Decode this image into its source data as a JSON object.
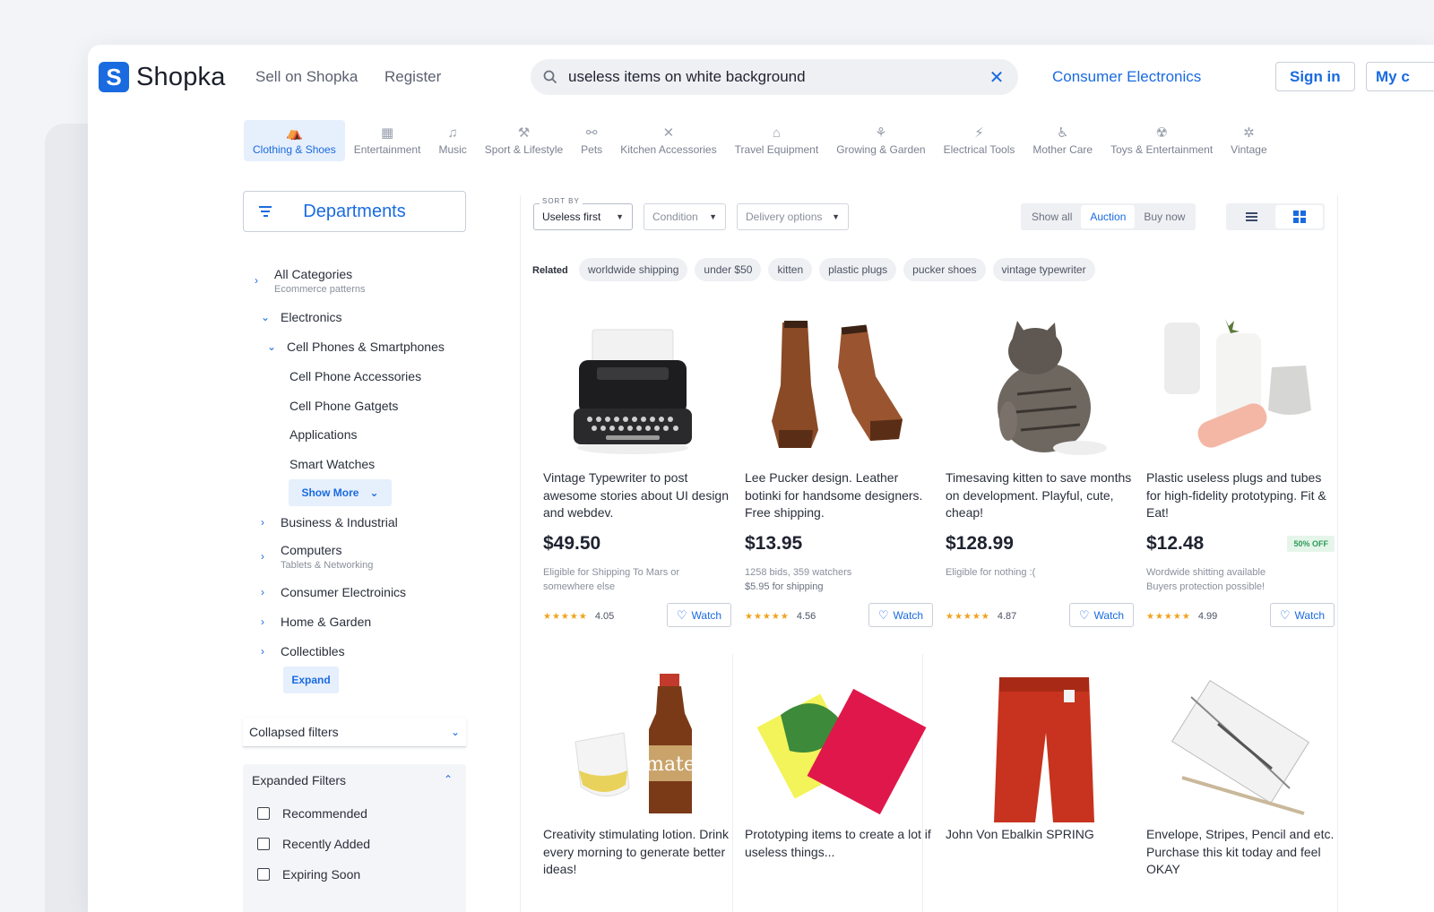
{
  "brand": {
    "mark": "S",
    "name": "Shopka"
  },
  "header": {
    "nav": [
      "Sell on Shopka",
      "Register"
    ],
    "search_value": "useless items on white background",
    "consumer_link": "Consumer Electronics",
    "sign_in": "Sign in",
    "my_label": "My c"
  },
  "categories": [
    {
      "label": "Clothing & Shoes",
      "icon": "hanger-icon",
      "glyph": "⛺",
      "active": true
    },
    {
      "label": "Entertainment",
      "icon": "film-icon",
      "glyph": "▦"
    },
    {
      "label": "Music",
      "icon": "music-note-icon",
      "glyph": "♫"
    },
    {
      "label": "Sport & Lifestyle",
      "icon": "racket-icon",
      "glyph": "⚒"
    },
    {
      "label": "Pets",
      "icon": "bone-icon",
      "glyph": "⚯"
    },
    {
      "label": "Kitchen Accessories",
      "icon": "utensils-icon",
      "glyph": "✕"
    },
    {
      "label": "Travel Equipment",
      "icon": "backpack-icon",
      "glyph": "⌂"
    },
    {
      "label": "Growing & Garden",
      "icon": "plant-icon",
      "glyph": "⚘"
    },
    {
      "label": "Electrical Tools",
      "icon": "plug-icon",
      "glyph": "⚡"
    },
    {
      "label": "Mother Care",
      "icon": "stroller-icon",
      "glyph": "♿"
    },
    {
      "label": "Toys & Entertainment",
      "icon": "toy-icon",
      "glyph": "☢"
    },
    {
      "label": "Vintage",
      "icon": "wheel-icon",
      "glyph": "✲"
    }
  ],
  "sidebar": {
    "departments": "Departments",
    "tree": {
      "all": "All Categories",
      "all_sub": "Ecommerce patterns",
      "electronics": "Electronics",
      "cell": "Cell Phones & Smartphones",
      "acc": "Cell Phone Accessories",
      "gat": "Cell Phone Gatgets",
      "apps": "Applications",
      "watches": "Smart Watches",
      "show_more": "Show More",
      "business": "Business & Industrial",
      "computers": "Computers",
      "computers_sub": "Tablets & Networking",
      "consumer": "Consumer Electroinics",
      "home": "Home & Garden",
      "collect": "Collectibles",
      "expand": "Expand"
    },
    "collapsed": "Collapsed filters",
    "expanded": "Expanded Filters",
    "checks": [
      "Recommended",
      "Recently Added",
      "Expiring Soon"
    ]
  },
  "toolbar": {
    "sort_label": "SORT BY",
    "sort_value": "Useless first",
    "condition": "Condition",
    "delivery": "Delivery options",
    "seg": [
      "Show all",
      "Auction",
      "Buy now"
    ],
    "active_seg": "Auction"
  },
  "related": {
    "label": "Related",
    "chips": [
      "worldwide shipping",
      "under $50",
      "kitten",
      "plastic plugs",
      "pucker shoes",
      "vintage typewriter"
    ]
  },
  "watch_label": "Watch",
  "products": [
    {
      "title": "Vintage Typewriter to post awesome stories about UI design and webdev.",
      "price": "$49.50",
      "meta1": "Eligible for Shipping To Mars or",
      "meta2": "somewhere else",
      "rating": "4.05",
      "image": "typewriter"
    },
    {
      "title": "Lee Pucker design. Leather botinki for handsome designers. Free shipping.",
      "price": "$13.95",
      "meta1": "1258 bids, 359 watchers",
      "meta2": "$5.95 for shipping",
      "rating": "4.56",
      "image": "boots"
    },
    {
      "title": "Timesaving kitten to save months on development. Playful, cute, cheap!",
      "price": "$128.99",
      "meta1": "",
      "meta2": "Eligible for nothing :(",
      "rating": "4.87",
      "image": "kitten"
    },
    {
      "title": "Plastic useless plugs and tubes for high-fidelity prototyping. Fit & Eat!",
      "price": "$12.48",
      "badge": "50% OFF",
      "meta1": "Wordwide shitting available",
      "meta2": "Buyers protection possible!",
      "rating": "4.99",
      "image": "plugs"
    },
    {
      "title": "Creativity stimulating lotion. Drink every morning to generate better ideas!",
      "image": "mate"
    },
    {
      "title": "Prototyping items to create a lot if useless things...",
      "image": "notebook"
    },
    {
      "title": "John Von Ebalkin SPRING",
      "image": "pants"
    },
    {
      "title": "Envelope, Stripes, Pencil and etc. Purchase this kit today and feel OKAY",
      "image": "envelope"
    }
  ],
  "colors": {
    "accent": "#1a6be0",
    "star": "#f0a21a",
    "badge_green": "#2e9b57"
  }
}
